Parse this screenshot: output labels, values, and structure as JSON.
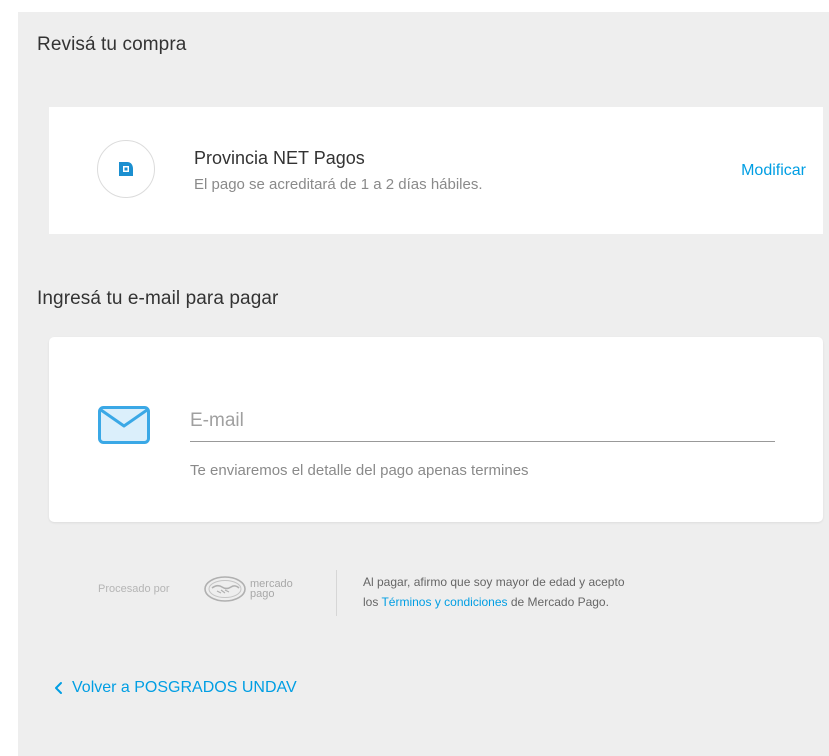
{
  "review": {
    "title": "Revisá tu compra"
  },
  "payment_method": {
    "icon": "provincia-net-icon",
    "name": "Provincia NET Pagos",
    "description": "El pago se acreditará de 1 a 2 días hábiles.",
    "modify_label": "Modificar"
  },
  "email_section": {
    "title": "Ingresá tu e-mail para pagar",
    "icon": "mail-icon",
    "input_placeholder": "E-mail",
    "input_value": "",
    "helper_text": "Te enviaremos el detalle del pago apenas termines"
  },
  "footer": {
    "processed_by": "Procesado por",
    "logo_word1": "mercado",
    "logo_word2": "pago",
    "legal_prefix": "Al pagar, afirmo que soy mayor de edad y acepto",
    "legal_los": "los",
    "terms_link": "Términos y condiciones",
    "legal_suffix": "de Mercado Pago."
  },
  "back": {
    "label": "Volver a POSGRADOS UNDAV"
  },
  "colors": {
    "accent": "#009ee3",
    "background": "#eeeeee",
    "card": "#ffffff"
  }
}
